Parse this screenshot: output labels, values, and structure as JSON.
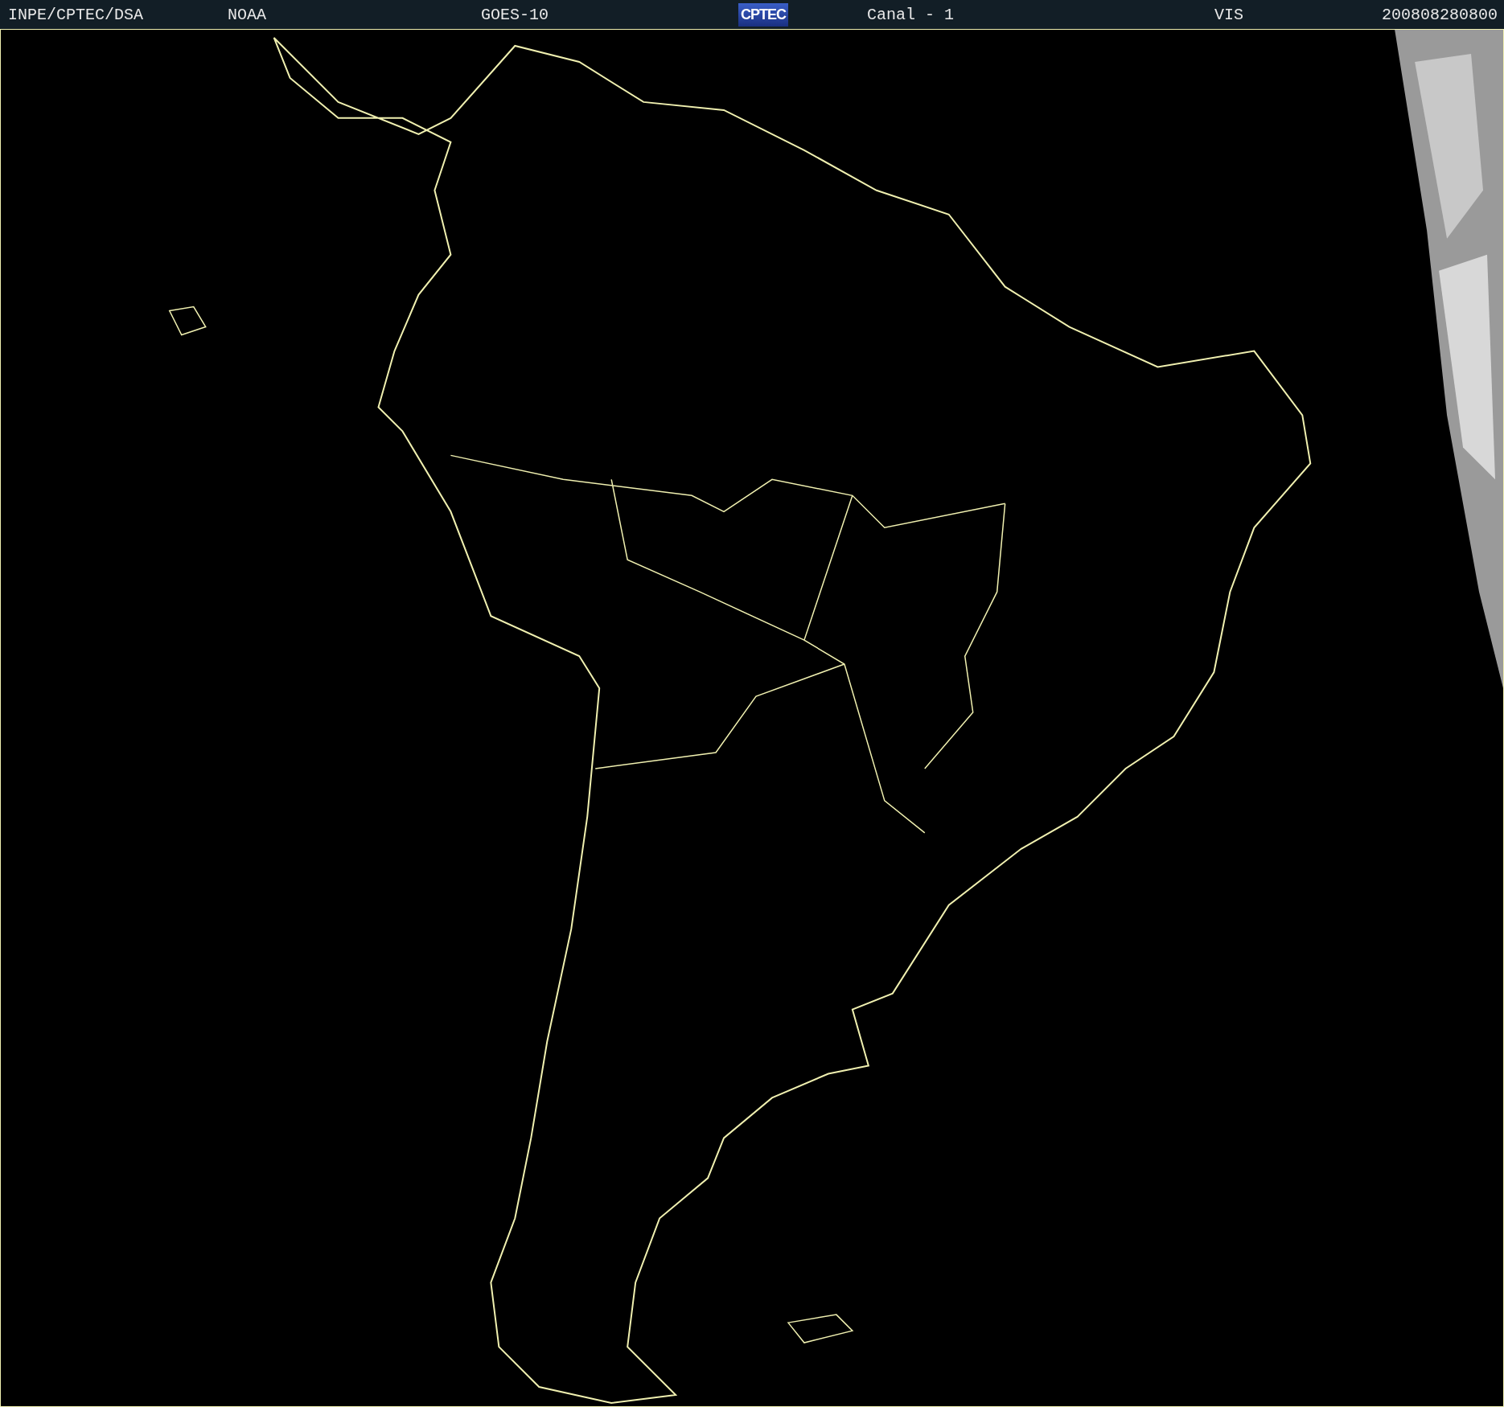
{
  "header": {
    "items": [
      {
        "kind": "text",
        "text": "INPE/CPTEC/DSA"
      },
      {
        "kind": "text",
        "text": "NOAA"
      },
      {
        "kind": "text",
        "text": "GOES-10"
      },
      {
        "kind": "logo",
        "text": "CPTEC"
      },
      {
        "kind": "text",
        "text": "Canal - 1"
      },
      {
        "kind": "text",
        "text": "VIS"
      },
      {
        "kind": "text",
        "text": "200808280800"
      }
    ]
  }
}
